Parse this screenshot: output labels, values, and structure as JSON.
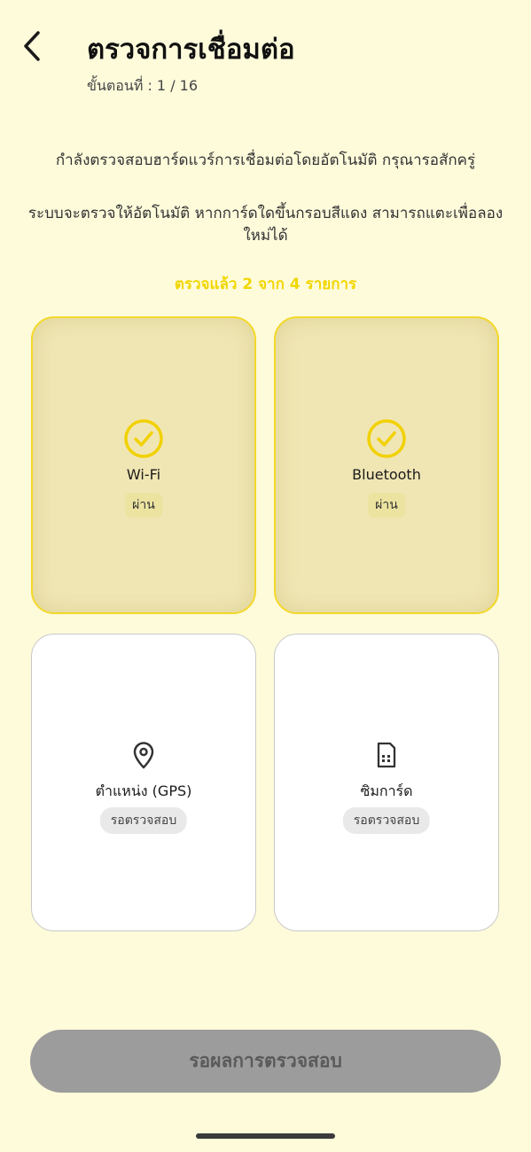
{
  "header": {
    "title": "ตรวจการเชื่อมต่อ",
    "step": "ขั้นตอนที่ :  1 / 16"
  },
  "description": {
    "line1": "กำลังตรวจสอบฮาร์ดแวร์การเชื่อมต่อโดยอัตโนมัติ กรุณารอสักครู่",
    "line2": "ระบบจะตรวจให้อัตโนมัติ หากการ์ดใดขึ้นกรอบสีแดง สามารถแตะเพื่อลองใหม่ได้"
  },
  "progress": {
    "text": "ตรวจแล้ว 2 จาก 4 รายการ",
    "checked": 2,
    "total": 4
  },
  "cards": [
    {
      "label": "Wi-Fi",
      "status": "ผ่าน",
      "icon": "check-circle-icon"
    },
    {
      "label": "Bluetooth",
      "status": "ผ่าน",
      "icon": "check-circle-icon"
    },
    {
      "label": "ตำแหน่ง (GPS)",
      "status": "รอตรวจสอบ",
      "icon": "location-pin-icon"
    },
    {
      "label": "ซิมการ์ด",
      "status": "รอตรวจสอบ",
      "icon": "sim-card-icon"
    }
  ],
  "footer": {
    "button_label": "รอผลการตรวจสอบ"
  },
  "colors": {
    "background": "#fefbdb",
    "accent": "#f2d600",
    "passed_card": "#f0e6b4",
    "button_disabled": "#9c9c9c"
  }
}
